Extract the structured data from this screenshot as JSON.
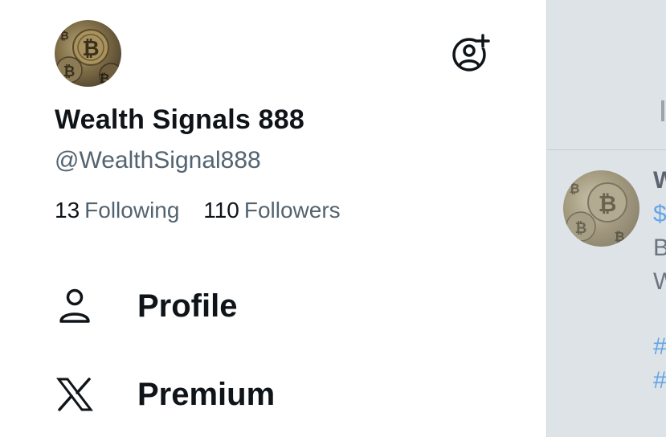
{
  "drawer": {
    "display_name": "Wealth Signals 888",
    "handle": "@WealthSignal888",
    "stats": [
      {
        "count": "13",
        "label": "Following"
      },
      {
        "count": "110",
        "label": "Followers"
      }
    ],
    "menu": [
      {
        "label": "Profile",
        "icon": "person-icon"
      },
      {
        "label": "Premium",
        "icon": "x-logo-icon"
      }
    ]
  },
  "feed": {
    "name_fragment": "W",
    "cashtag_fragment": "$",
    "line1_fragment": "B",
    "line2_fragment": "W",
    "hashtag1_fragment": "#",
    "hashtag2_fragment": "#"
  },
  "colors": {
    "text_primary": "#0f1419",
    "text_secondary": "#536471",
    "link": "#1d9bf0",
    "feed_overlay": "#dee3e8"
  }
}
